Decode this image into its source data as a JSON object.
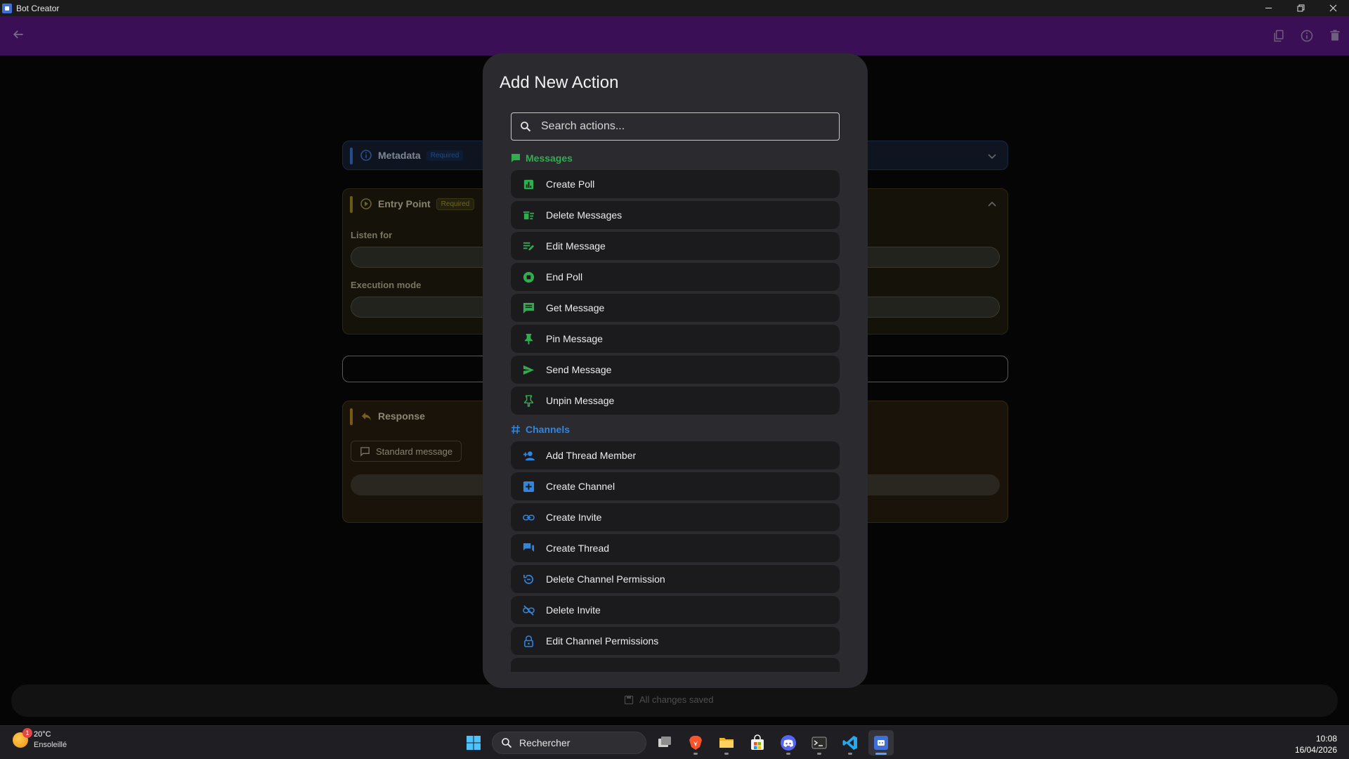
{
  "window": {
    "title": "Bot Creator"
  },
  "colors": {
    "appbar": "#3b0f55",
    "dialog_bg": "#2b2a2f",
    "messages_accent": "#2fae4e",
    "channels_accent": "#2e86e0"
  },
  "background": {
    "metadata": {
      "title": "Metadata",
      "tag": "Required"
    },
    "entry_point": {
      "title": "Entry Point",
      "tag": "Required",
      "listen_for_label": "Listen for",
      "execution_mode_label": "Execution mode"
    },
    "response": {
      "title": "Response",
      "standard_message_label": "Standard message"
    },
    "status": "All changes saved"
  },
  "dialog": {
    "title": "Add New Action",
    "search_placeholder": "Search actions...",
    "sections": [
      {
        "name": "Messages",
        "icon": "chat-bubble-icon",
        "items": [
          {
            "label": "Create Poll",
            "icon": "poll-icon"
          },
          {
            "label": "Delete Messages",
            "icon": "delete-sweep-icon"
          },
          {
            "label": "Edit Message",
            "icon": "edit-note-icon"
          },
          {
            "label": "End Poll",
            "icon": "stop-circle-icon"
          },
          {
            "label": "Get Message",
            "icon": "message-icon"
          },
          {
            "label": "Pin Message",
            "icon": "pin-icon"
          },
          {
            "label": "Send Message",
            "icon": "send-icon"
          },
          {
            "label": "Unpin Message",
            "icon": "unpin-icon"
          }
        ]
      },
      {
        "name": "Channels",
        "icon": "hashtag-icon",
        "items": [
          {
            "label": "Add Thread Member",
            "icon": "person-add-icon"
          },
          {
            "label": "Create Channel",
            "icon": "add-box-icon"
          },
          {
            "label": "Create Invite",
            "icon": "link-icon"
          },
          {
            "label": "Create Thread",
            "icon": "forum-icon"
          },
          {
            "label": "Delete Channel Permission",
            "icon": "remove-permission-icon"
          },
          {
            "label": "Delete Invite",
            "icon": "link-off-icon"
          },
          {
            "label": "Edit Channel Permissions",
            "icon": "lock-icon"
          }
        ]
      }
    ]
  },
  "taskbar": {
    "weather_temp": "20°C",
    "weather_desc": "Ensoleillé",
    "weather_badge": "1",
    "search_label": "Rechercher",
    "time": "10:08",
    "date": "16/04/2026"
  }
}
